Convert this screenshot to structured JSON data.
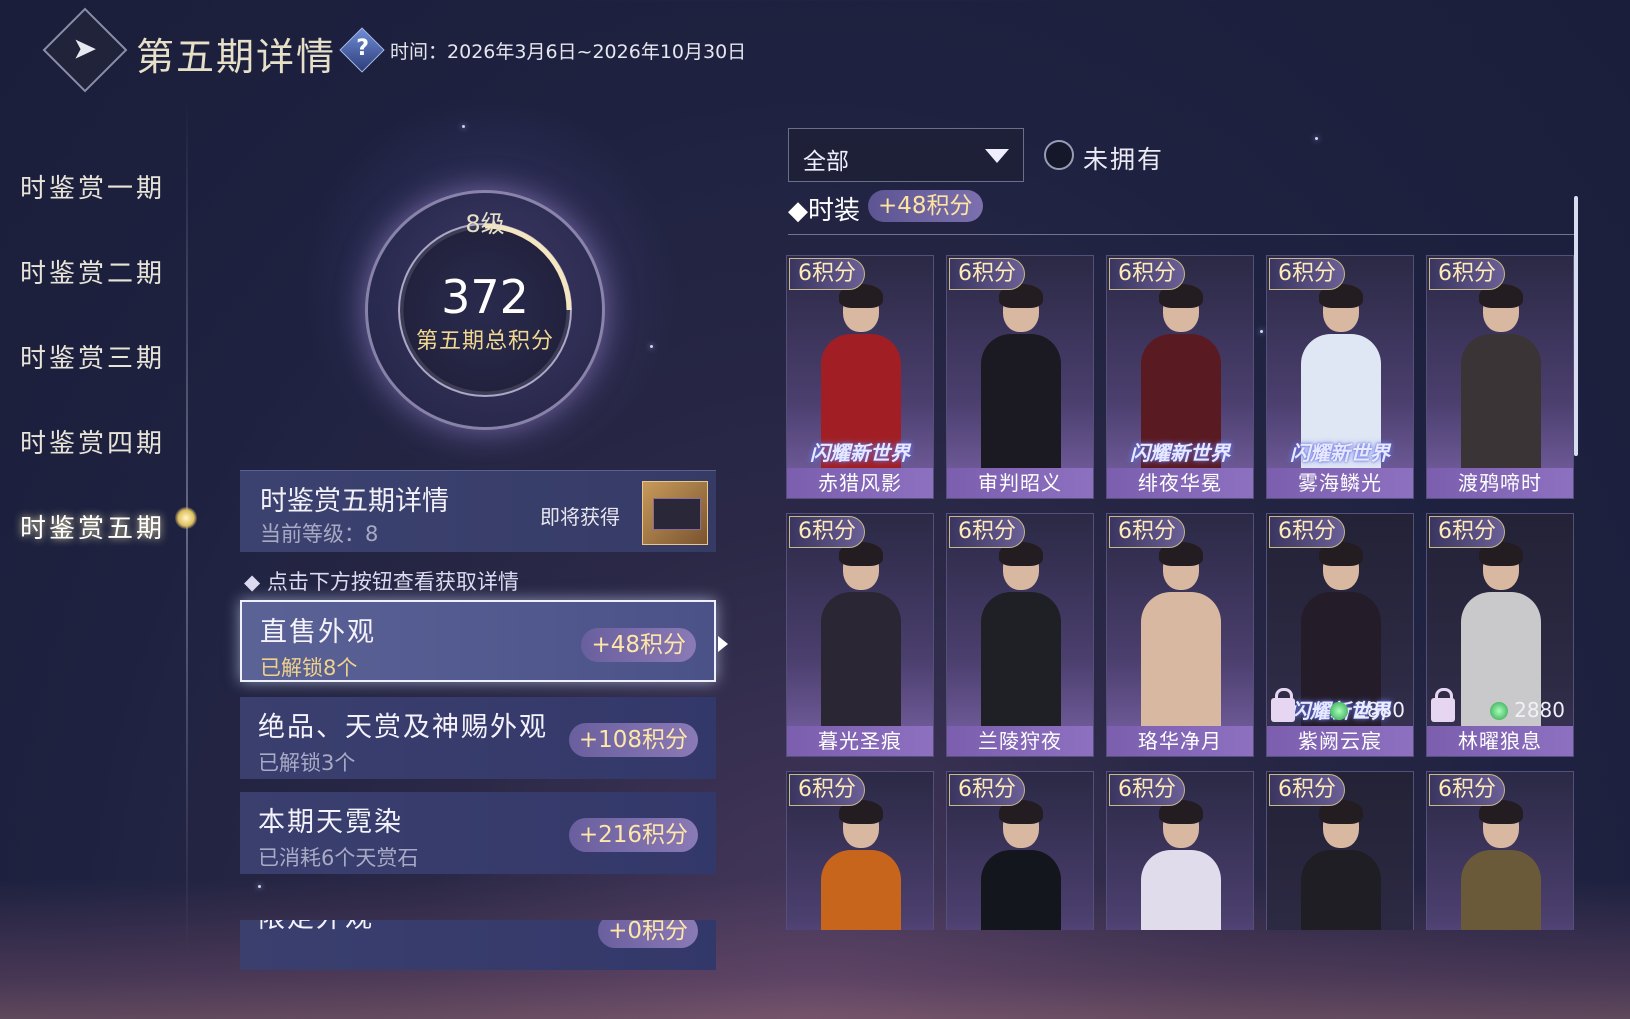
{
  "header": {
    "back_icon": "back-arrow-icon",
    "title": "第五期详情",
    "help_glyph": "?",
    "time_label": "时间：",
    "time_range": "2026年3月6日~2026年10月30日"
  },
  "sidebar": {
    "items": [
      {
        "label": "时鉴赏一期"
      },
      {
        "label": "时鉴赏二期"
      },
      {
        "label": "时鉴赏三期"
      },
      {
        "label": "时鉴赏四期"
      },
      {
        "label": "时鉴赏五期",
        "active": true
      }
    ]
  },
  "score": {
    "level": "8级",
    "total": "372",
    "label": "第五期总积分",
    "level_progress": 0.25
  },
  "detail": {
    "title": "时鉴赏五期详情",
    "current_level": "当前等级：8",
    "soon_label": "即将获得"
  },
  "hint": "点击下方按钮查看获取详情",
  "categories": [
    {
      "title": "直售外观",
      "sub": "已解锁8个",
      "points": "+48积分",
      "active": true
    },
    {
      "title": "绝品、天赏及神赐外观",
      "sub": "已解锁3个",
      "points": "+108积分"
    },
    {
      "title": "本期天霓染",
      "sub": "已消耗6个天赏石",
      "points": "+216积分"
    },
    {
      "title": "限定外观",
      "sub": "",
      "points": "+0积分"
    }
  ],
  "filter": {
    "dropdown_value": "全部",
    "checkbox_label": "未拥有"
  },
  "section": {
    "title": "时装",
    "points": "+48积分"
  },
  "outfits": [
    {
      "points": "6积分",
      "name": "赤猎风影",
      "logo": "闪耀新世界",
      "color": "#a11f24",
      "dark": false
    },
    {
      "points": "6积分",
      "name": "审判昭义",
      "logo": "",
      "color": "#1b1a22",
      "dark": false
    },
    {
      "points": "6积分",
      "name": "绯夜华冕",
      "logo": "闪耀新世界",
      "color": "#5a1a22",
      "dark": false
    },
    {
      "points": "6积分",
      "name": "雾海鳞光",
      "logo": "闪耀新世界",
      "color": "#dfe6f4",
      "dark": false
    },
    {
      "points": "6积分",
      "name": "渡鸦啼时",
      "logo": "",
      "color": "#3a3436",
      "dark": false
    },
    {
      "points": "6积分",
      "name": "暮光圣痕",
      "logo": "",
      "color": "#2a2634",
      "dark": false
    },
    {
      "points": "6积分",
      "name": "兰陵狩夜",
      "logo": "",
      "color": "#1f2026",
      "dark": false
    },
    {
      "points": "6积分",
      "name": "珞华净月",
      "logo": "",
      "color": "#d8b8a0",
      "dark": false
    },
    {
      "points": "6积分",
      "name": "紫阙云宸",
      "logo": "闪耀新世界",
      "color": "#241c28",
      "dark": true,
      "locked": true,
      "price": "2880"
    },
    {
      "points": "6积分",
      "name": "林曜狼息",
      "logo": "",
      "color": "#c9c9cc",
      "dark": true,
      "locked": true,
      "price": "2880"
    },
    {
      "points": "6积分",
      "name": "",
      "logo": "",
      "color": "#c8651c",
      "dark": false
    },
    {
      "points": "6积分",
      "name": "",
      "logo": "",
      "color": "#14161e",
      "dark": false
    },
    {
      "points": "6积分",
      "name": "",
      "logo": "",
      "color": "#e0dcec",
      "dark": false
    },
    {
      "points": "6积分",
      "name": "",
      "logo": "",
      "color": "#1e1e24",
      "dark": true
    },
    {
      "points": "6积分",
      "name": "",
      "logo": "",
      "color": "#6a5a3a",
      "dark": false
    }
  ]
}
